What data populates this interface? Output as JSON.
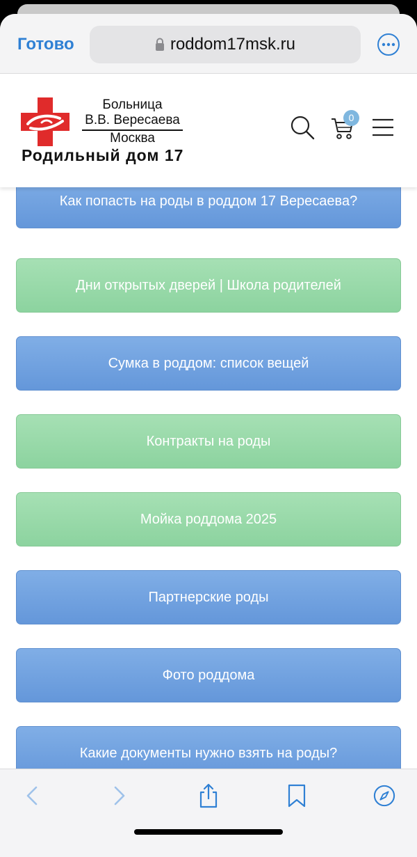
{
  "browser": {
    "done_label": "Готово",
    "url": "roddom17msk.ru"
  },
  "logo": {
    "line1": "Больница",
    "line2": "В.В. Вересаева",
    "line3": "Москва",
    "title": "Родильный дом 17",
    "colors": {
      "cross": "#e02b2b"
    }
  },
  "header": {
    "cart_count": "0"
  },
  "tiles": [
    {
      "label": "Как попасть на роды в роддом 17 Вересаева?",
      "color": "blue"
    },
    {
      "label": "Дни открытых дверей | Школа родителей",
      "color": "green"
    },
    {
      "label": "Сумка в роддом: список вещей",
      "color": "blue"
    },
    {
      "label": "Контракты на роды",
      "color": "green"
    },
    {
      "label": "Мойка роддома 2025",
      "color": "green"
    },
    {
      "label": "Партнерские роды",
      "color": "blue"
    },
    {
      "label": "Фото роддома",
      "color": "blue"
    },
    {
      "label": "Какие документы нужно взять на роды?",
      "color": "blue"
    }
  ],
  "toolbar_icons": [
    "back-icon",
    "forward-icon",
    "share-icon",
    "bookmarks-icon",
    "safari-compass-icon"
  ],
  "colors": {
    "accent": "#2f80d4",
    "tile_blue": "#6f9fe0",
    "tile_green": "#97d9a9"
  }
}
